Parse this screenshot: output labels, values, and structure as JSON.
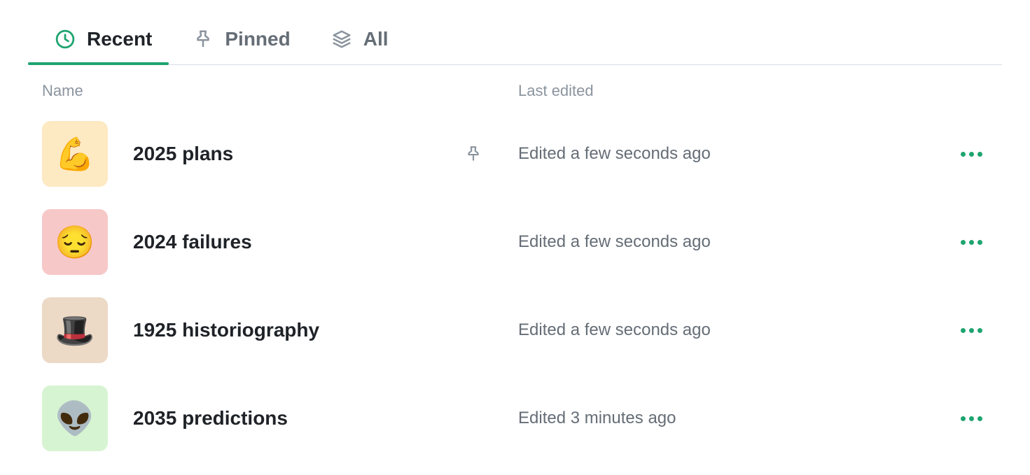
{
  "colors": {
    "accent": "#1ea470",
    "muted": "#8b949e",
    "text": "#1f2328",
    "subtext": "#656d76"
  },
  "tabs": [
    {
      "id": "recent",
      "label": "Recent",
      "icon": "clock-icon",
      "active": true
    },
    {
      "id": "pinned",
      "label": "Pinned",
      "icon": "pin-icon",
      "active": false
    },
    {
      "id": "all",
      "label": "All",
      "icon": "stack-icon",
      "active": false
    }
  ],
  "columns": {
    "name": "Name",
    "last_edited": "Last edited"
  },
  "items": [
    {
      "emoji": "💪",
      "bg": "#fde9c2",
      "title": "2025 plans",
      "pinned": true,
      "edited": "Edited a few seconds ago"
    },
    {
      "emoji": "😔",
      "bg": "#f7c8c8",
      "title": "2024 failures",
      "pinned": false,
      "edited": "Edited a few seconds ago"
    },
    {
      "emoji": "🎩",
      "bg": "#ecd9c6",
      "title": "1925 historiography",
      "pinned": false,
      "edited": "Edited a few seconds ago"
    },
    {
      "emoji": "👽",
      "bg": "#d7f4d2",
      "title": "2035 predictions",
      "pinned": false,
      "edited": "Edited 3 minutes ago"
    }
  ]
}
